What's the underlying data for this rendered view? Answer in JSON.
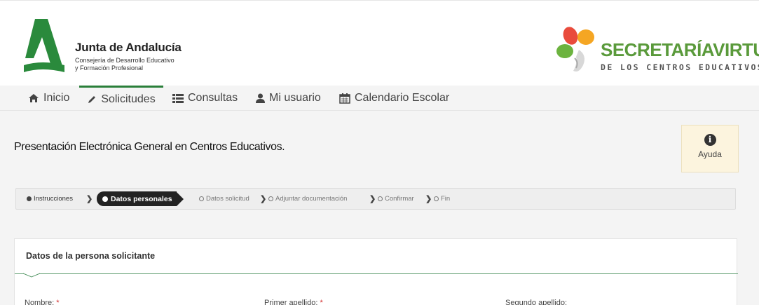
{
  "header": {
    "org_title": "Junta de Andalucía",
    "org_sub_line1": "Consejería de Desarrollo Educativo",
    "org_sub_line2": "y Formación Profesional",
    "brand_word1": "SECRETARÍA",
    "brand_word2": "VIRTUAL",
    "brand_sub": "DE LOS CENTROS EDUCATIVOS"
  },
  "nav": {
    "items": [
      {
        "label": "Inicio",
        "icon": "home-icon"
      },
      {
        "label": "Solicitudes",
        "icon": "pencil-icon",
        "active": true
      },
      {
        "label": "Consultas",
        "icon": "list-icon"
      },
      {
        "label": "Mi usuario",
        "icon": "user-icon"
      },
      {
        "label": "Calendario Escolar",
        "icon": "calendar-icon"
      }
    ]
  },
  "page": {
    "title": "Presentación Electrónica General en Centros Educativos."
  },
  "help": {
    "label": "Ayuda",
    "icon": "info-icon"
  },
  "steps": {
    "items": [
      {
        "label": "Instrucciones",
        "state": "done"
      },
      {
        "label": "Datos personales",
        "state": "active"
      },
      {
        "label": "Datos solicitud",
        "state": "pending"
      },
      {
        "label": "Adjuntar documentación",
        "state": "pending"
      },
      {
        "label": "Confirmar",
        "state": "pending"
      },
      {
        "label": "Fin",
        "state": "pending"
      }
    ]
  },
  "form": {
    "section_title": "Datos de la persona solicitante",
    "fields": [
      {
        "label": "Nombre:",
        "required": "*"
      },
      {
        "label": "Primer apellido:",
        "required": "*"
      },
      {
        "label": "Segundo apellido:",
        "required": ""
      }
    ]
  },
  "colors": {
    "brand_green": "#2a7f3a",
    "sv_green": "#5a9a3b",
    "help_bg": "#fcf4de",
    "required_red": "#d32f2f"
  }
}
